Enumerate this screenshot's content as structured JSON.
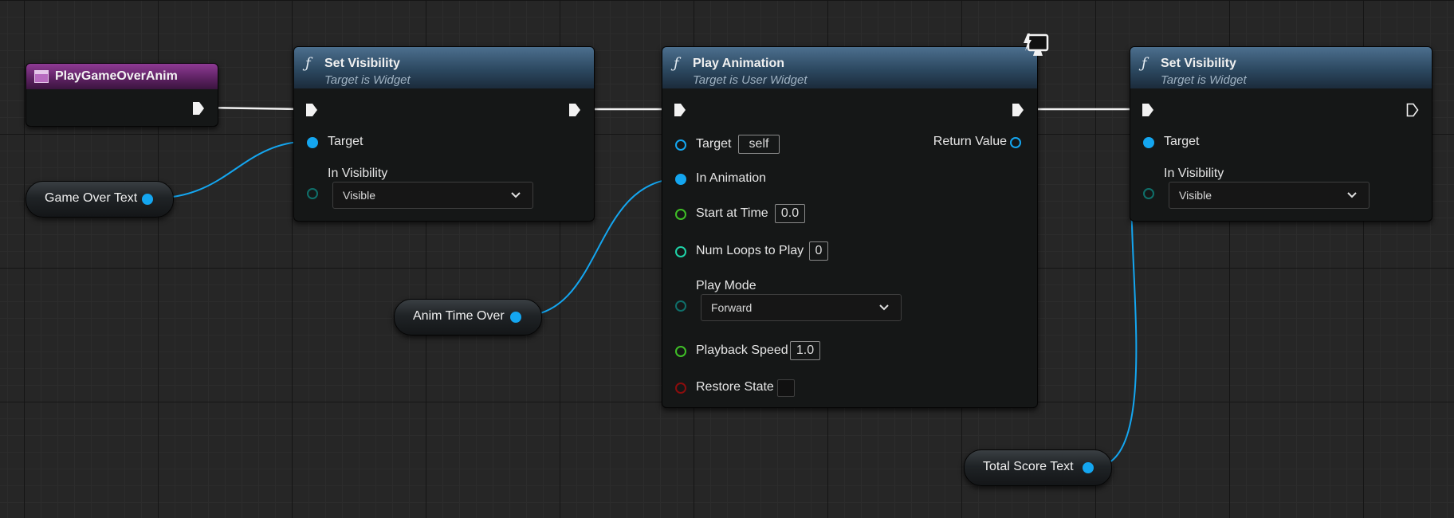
{
  "event_node": {
    "title": "PlayGameOverAnim"
  },
  "set_visibility_1": {
    "title": "Set Visibility",
    "subtitle": "Target is Widget",
    "target_label": "Target",
    "visibility_label": "In Visibility",
    "visibility_value": "Visible"
  },
  "play_animation": {
    "title": "Play Animation",
    "subtitle": "Target is User Widget",
    "target_label": "Target",
    "target_value": "self",
    "return_label": "Return Value",
    "in_animation_label": "In Animation",
    "start_time_label": "Start at Time",
    "start_time_value": "0.0",
    "num_loops_label": "Num Loops to Play",
    "num_loops_value": "0",
    "play_mode_label": "Play Mode",
    "play_mode_value": "Forward",
    "playback_speed_label": "Playback Speed",
    "playback_speed_value": "1.0",
    "restore_state_label": "Restore State"
  },
  "set_visibility_2": {
    "title": "Set Visibility",
    "subtitle": "Target is Widget",
    "target_label": "Target",
    "visibility_label": "In Visibility",
    "visibility_value": "Visible"
  },
  "variables": {
    "game_over_text": "Game Over Text",
    "anim_time_over": "Anim Time Over",
    "total_score_text": "Total Score Text"
  },
  "icons": {
    "function": "function-icon",
    "exec": "exec-pin-icon",
    "event": "event-icon",
    "client_only": "client-only-monitor-icon"
  },
  "colors": {
    "object_pin": "#14a6f0",
    "float_pin": "#3fbf27",
    "int_pin": "#1fd3a8",
    "byte_pin": "#0f6f6a",
    "bool_pin": "#8a0d0d",
    "event_header": "#7a2a80",
    "function_header": "#3d6482"
  }
}
